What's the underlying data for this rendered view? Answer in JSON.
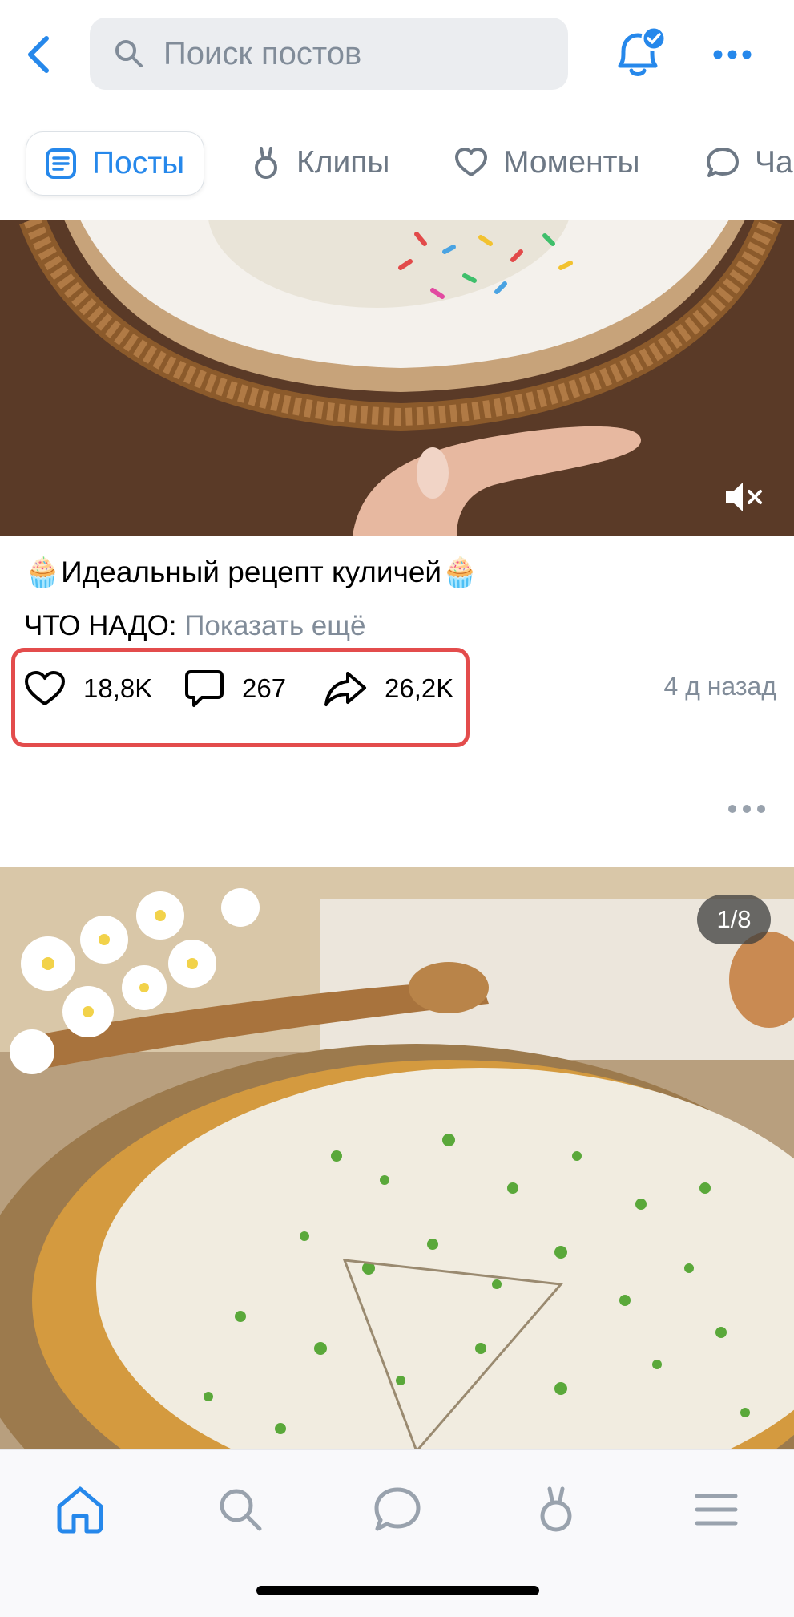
{
  "header": {
    "search_placeholder": "Поиск постов",
    "icons": [
      "back-chevron-icon",
      "search-icon",
      "bell-verified-icon",
      "more-horizontal-icon"
    ]
  },
  "tabs": [
    {
      "label": "Посты",
      "icon": "posts-icon",
      "active": true
    },
    {
      "label": "Клипы",
      "icon": "clips-icon",
      "active": false
    },
    {
      "label": "Моменты",
      "icon": "moments-icon",
      "active": false
    },
    {
      "label": "Ча",
      "icon": "chat-icon",
      "active": false
    }
  ],
  "post1": {
    "title": "🧁Идеальный рецепт куличей🧁",
    "description": "ЧТО НАДО:",
    "show_more": "Показать ещё",
    "likes": "18,8K",
    "comments": "267",
    "shares": "26,2K",
    "time": "4 д назад"
  },
  "post2": {
    "counter": "1/8"
  },
  "bottom_nav": [
    {
      "name": "home",
      "icon": "home-icon",
      "active": true
    },
    {
      "name": "search",
      "icon": "search-icon",
      "active": false
    },
    {
      "name": "messages",
      "icon": "messages-icon",
      "active": false
    },
    {
      "name": "clips",
      "icon": "clips-icon",
      "active": false
    },
    {
      "name": "menu",
      "icon": "menu-icon",
      "active": false
    }
  ],
  "colors": {
    "accent": "#2688eb",
    "secondary_text": "#818c99",
    "highlight_box": "#e34c4c"
  }
}
